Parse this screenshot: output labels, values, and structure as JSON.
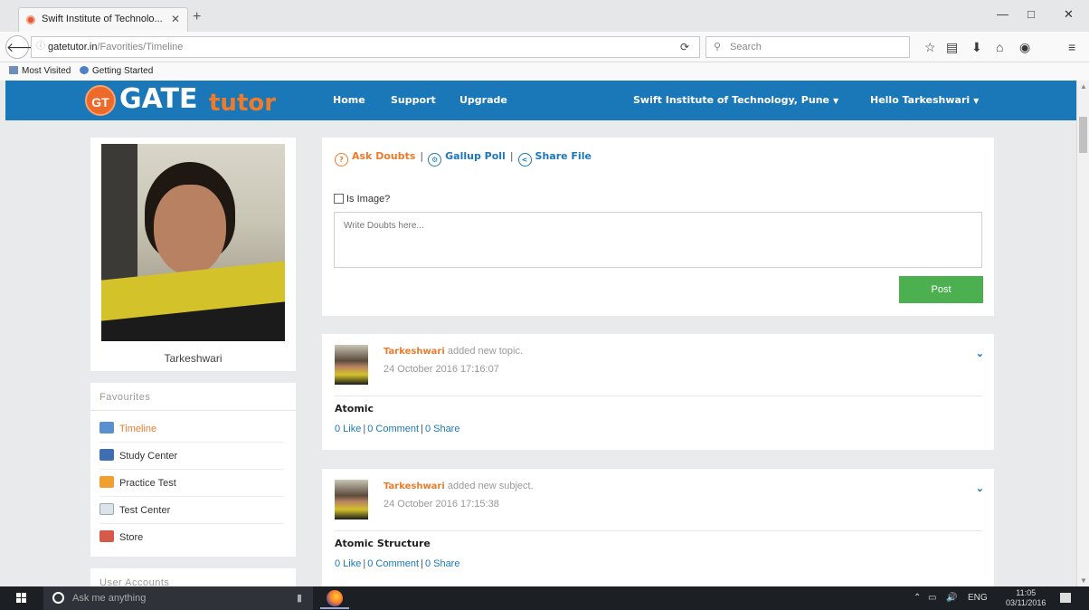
{
  "browser": {
    "tab_title": "Swift Institute of Technolo...",
    "tab_close": "✕",
    "new_tab": "+",
    "url_domain": "gatetutor.in",
    "url_path": "/Favorities/Timeline",
    "search_placeholder": "Search",
    "bookmarks": [
      "Most Visited",
      "Getting Started"
    ]
  },
  "header": {
    "logo_badge": "GT",
    "logo_main": "GATE",
    "logo_sub": "tutor",
    "nav": [
      "Home",
      "Support",
      "Upgrade"
    ],
    "institute": "Swift Institute of Technology, Pune",
    "greeting": "Hello Tarkeshwari",
    "brand_color": "#1b78b8",
    "accent_color": "#ee7b2b"
  },
  "profile": {
    "name": "Tarkeshwari"
  },
  "favourites": {
    "title": "Favourites",
    "items": [
      {
        "label": "Timeline",
        "icon": "timeline-icon",
        "active": true
      },
      {
        "label": "Study Center",
        "icon": "study-center-icon",
        "active": false
      },
      {
        "label": "Practice Test",
        "icon": "practice-test-icon",
        "active": false
      },
      {
        "label": "Test Center",
        "icon": "test-center-icon",
        "active": false
      },
      {
        "label": "Store",
        "icon": "store-icon",
        "active": false
      }
    ]
  },
  "user_accounts": {
    "title": "User Accounts"
  },
  "composer": {
    "tabs": [
      "Ask Doubts",
      "Gallup Poll",
      "Share File"
    ],
    "is_image_label": "Is Image?",
    "placeholder": "Write Doubts here...",
    "post_button": "Post"
  },
  "posts": [
    {
      "author": "Tarkeshwari",
      "action": "added new topic.",
      "date": "24 October 2016 17:16:07",
      "topic": "Atomic",
      "likes": "0 Like",
      "comments": "0 Comment",
      "shares": "0 Share"
    },
    {
      "author": "Tarkeshwari",
      "action": "added new subject.",
      "date": "24 October 2016 17:15:38",
      "topic": "Atomic Structure",
      "likes": "0 Like",
      "comments": "0 Comment",
      "shares": "0 Share"
    }
  ],
  "taskbar": {
    "search_placeholder": "Ask me anything",
    "language": "ENG",
    "time": "11:05",
    "date": "03/11/2016"
  }
}
